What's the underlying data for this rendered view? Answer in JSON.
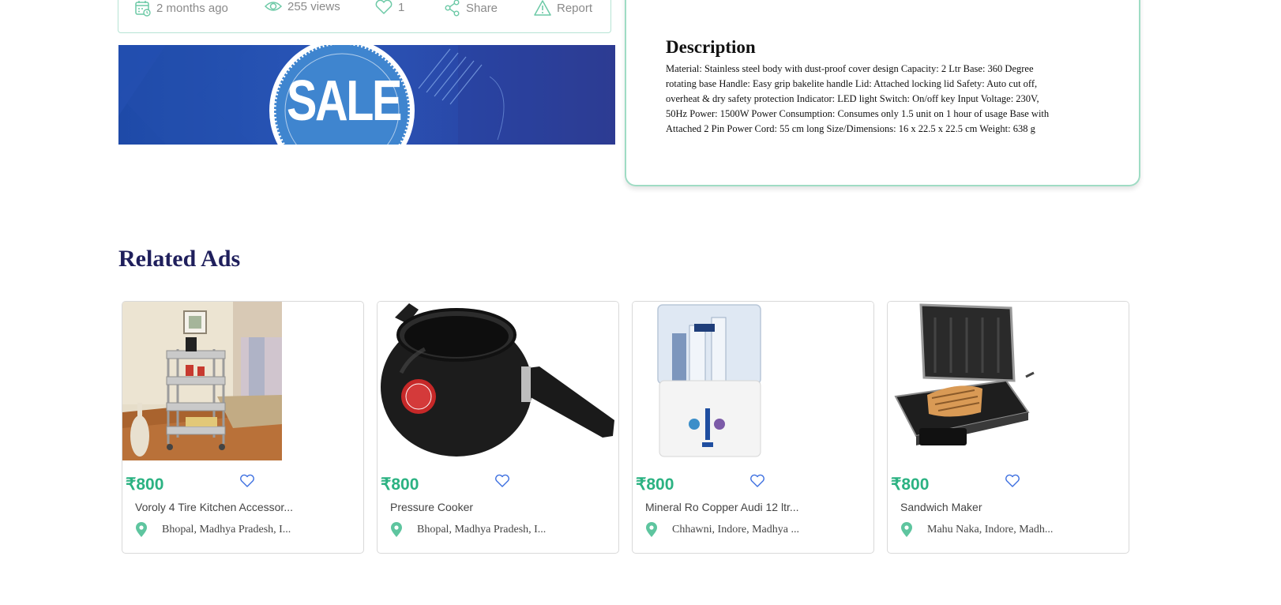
{
  "meta": {
    "posted": "2 months ago",
    "views": "255 views",
    "likes": "1",
    "share": "Share",
    "report": "Report",
    "icons": [
      "calendar-icon",
      "eye-icon",
      "heart-icon",
      "share-icon",
      "warning-icon"
    ]
  },
  "banner": {
    "text": "SALE"
  },
  "description": {
    "title": "Description",
    "text": "Material: Stainless steel body with dust-proof cover design Capacity: 2 Ltr Base: 360 Degree rotating base Handle: Easy grip bakelite handle Lid: Attached locking lid Safety: Auto cut off, overheat & dry safety protection Indicator: LED light Switch: On/off key Input Voltage: 230V, 50Hz Power: 1500W Power Consumption: Consumes only 1.5 unit on 1 hour of usage Base with Attached 2 Pin Power Cord: 55 cm long Size/Dimensions: 16 x 22.5 x 22.5 cm Weight: 638 g"
  },
  "related": {
    "title": "Related Ads",
    "ads": [
      {
        "price": "₹800",
        "title": "Voroly 4 Tire Kitchen Accessor...",
        "location": "Bhopal, Madhya Pradesh, I...",
        "image": "kitchen-trolley-image"
      },
      {
        "price": "₹800",
        "title": "Pressure Cooker",
        "location": "Bhopal, Madhya Pradesh, I...",
        "image": "pressure-cooker-image"
      },
      {
        "price": "₹800",
        "title": "Mineral Ro Copper Audi 12 ltr...",
        "location": "Chhawni, Indore, Madhya ...",
        "image": "water-purifier-image"
      },
      {
        "price": "₹800",
        "title": "Sandwich Maker",
        "location": "Mahu Naka, Indore, Madh...",
        "image": "sandwich-maker-image"
      }
    ]
  },
  "colors": {
    "accent": "#2bb282",
    "border_green": "#9fdcc4",
    "heading_navy": "#1f1f5c",
    "banner_blue": "#2a56b8"
  }
}
